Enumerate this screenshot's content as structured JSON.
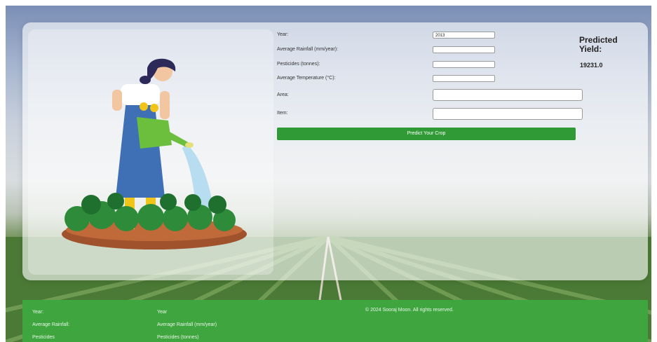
{
  "form": {
    "year_label": "Year:",
    "year_value": "2013",
    "rainfall_label": "Average Rainfall (mm/year):",
    "rainfall_value": "",
    "pesticides_label": "Pesticides (tonnes):",
    "pesticides_value": "",
    "temperature_label": "Average Temperature (°C):",
    "temperature_value": "",
    "area_label": "Area:",
    "area_value": "",
    "item_label": "Item:",
    "item_value": "",
    "submit_label": "Predict Your Crop"
  },
  "result": {
    "title": "Predicted Yield:",
    "value": "19231.0"
  },
  "footer": {
    "col1": [
      "Year:",
      "Average Rainfall:",
      "Pesticides"
    ],
    "col2": [
      "Year",
      "Average Rainfall (mm/year)",
      "Pesticides (tonnes)"
    ],
    "copyright": "© 2024 Sooraj Moon. All rights reserved."
  },
  "colors": {
    "accent_green": "#2f9a36",
    "footer_green": "#3ea53f"
  },
  "illustration": "woman-watering-plants"
}
